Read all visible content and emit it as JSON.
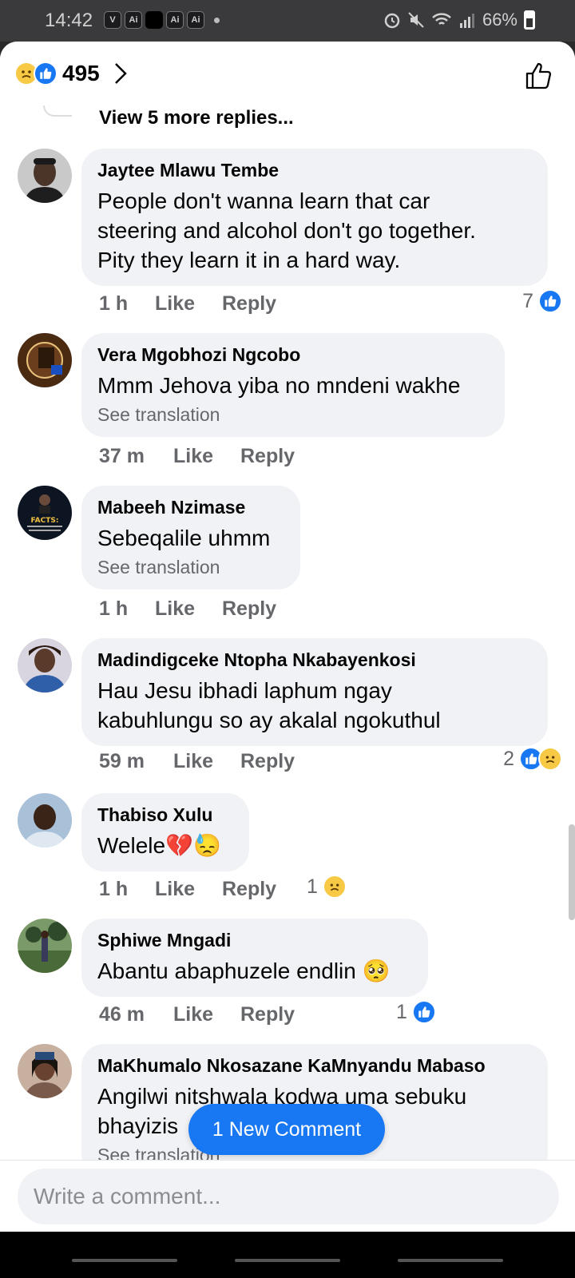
{
  "status_bar": {
    "time": "14:42",
    "apps": [
      "V",
      "Ai",
      "",
      "Ai",
      "Ai"
    ],
    "battery": "66%"
  },
  "header": {
    "reaction_count": "495",
    "reaction_icons": [
      "sad-icon",
      "like-icon"
    ]
  },
  "view_more": "View 5 more replies...",
  "comments": [
    {
      "name": "Jaytee Mlawu Tembe",
      "text": "People don't wanna learn that car\nsteering and alcohol don't go together.\nPity they learn it in a hard way.",
      "translation": "",
      "time": "1 h",
      "like": "Like",
      "reply": "Reply",
      "reaction_count": "7",
      "reactions": [
        "like-icon"
      ],
      "avatar_color": "#3b3b3b"
    },
    {
      "name": "Vera Mgobhozi Ngcobo",
      "text": "Mmm Jehova yiba no mndeni wakhe",
      "translation": "See translation",
      "time": "37 m",
      "like": "Like",
      "reply": "Reply",
      "reaction_count": "",
      "reactions": [],
      "avatar_color": "#5a3a1e"
    },
    {
      "name": "Mabeeh Nzimase",
      "text": "Sebeqalile uhmm",
      "translation": "See translation",
      "time": "1 h",
      "like": "Like",
      "reply": "Reply",
      "reaction_count": "",
      "reactions": [],
      "avatar_color": "#0d1a2a"
    },
    {
      "name": "Madindigceke Ntopha Nkabayenkosi",
      "text": "Hau Jesu ibhadi laphum ngay\nkabuhlungu so ay akalal ngokuthul",
      "translation": "",
      "time": "59 m",
      "like": "Like",
      "reply": "Reply",
      "reaction_count": "2",
      "reactions": [
        "like-icon",
        "sad-icon"
      ],
      "avatar_color": "#6b4a3a"
    },
    {
      "name": "Thabiso Xulu",
      "text": "Welele💔😓",
      "translation": "",
      "time": "1 h",
      "like": "Like",
      "reply": "Reply",
      "reaction_count": "1",
      "reactions": [
        "sad-icon"
      ],
      "avatar_color": "#4a6a8a"
    },
    {
      "name": "Sphiwe Mngadi",
      "text": "Abantu abaphuzele endlin 🥺",
      "translation": "",
      "time": "46 m",
      "like": "Like",
      "reply": "Reply",
      "reaction_count": "1",
      "reactions": [
        "like-icon"
      ],
      "avatar_color": "#3f5a3a"
    },
    {
      "name": "MaKhumalo Nkosazane KaMnyandu Mabaso",
      "text": "Angilwi nitshwala kodwa uma sebuku\nbhayizis",
      "translation": "See translation",
      "time": "",
      "like": "",
      "reply": "",
      "reaction_count": "",
      "reactions": [],
      "avatar_color": "#8a6a5a"
    }
  ],
  "new_comment_pill": "1 New Comment",
  "composer": {
    "placeholder": "Write a comment..."
  },
  "colors": {
    "accent": "#1877f2",
    "bubble": "#f0f2f5",
    "meta_text": "#65676b"
  }
}
